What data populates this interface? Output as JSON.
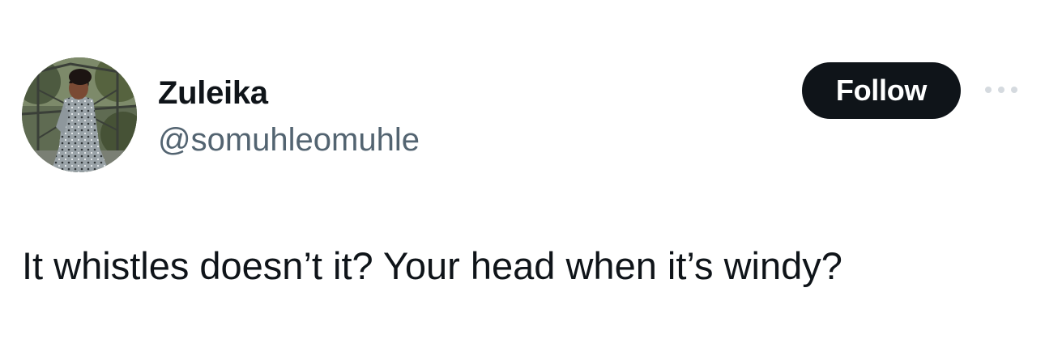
{
  "tweet": {
    "author": {
      "display_name": "Zuleika",
      "handle": "@somuhleomuhle",
      "avatar_icon": "profile-photo-woman-patterned-dress"
    },
    "follow_label": "Follow",
    "more_icon": "ellipsis-horizontal-icon",
    "text": "It whistles doesn’t it? Your head when it’s windy?"
  },
  "colors": {
    "text_primary": "#0f1419",
    "text_secondary": "#536471",
    "button_bg": "#0f1419",
    "button_text": "#ffffff",
    "background": "#ffffff"
  }
}
